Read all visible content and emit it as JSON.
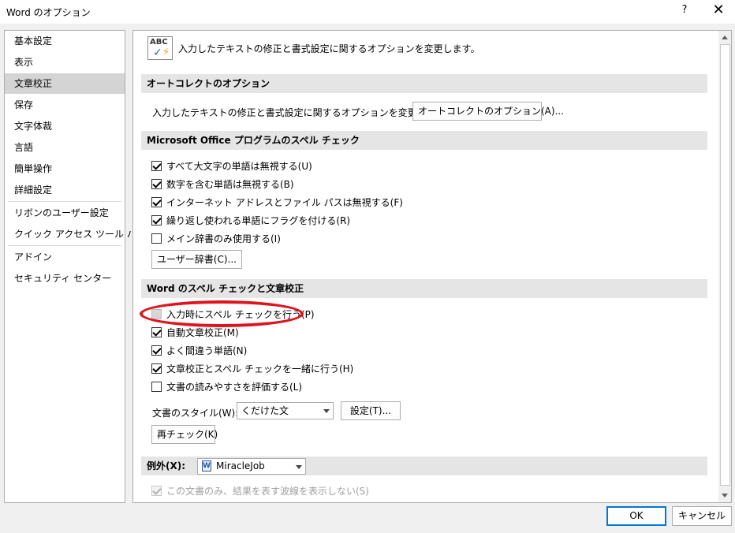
{
  "window": {
    "title": "Word のオプション",
    "help": "?",
    "close": "✕"
  },
  "sidebar": {
    "items": [
      {
        "label": "基本設定"
      },
      {
        "label": "表示"
      },
      {
        "label": "文章校正",
        "selected": true
      },
      {
        "label": "保存"
      },
      {
        "label": "文字体裁"
      },
      {
        "label": "言語"
      },
      {
        "label": "簡単操作"
      },
      {
        "label": "詳細設定"
      },
      {
        "label": "リボンのユーザー設定"
      },
      {
        "label": "クイック アクセス ツール バー"
      },
      {
        "label": "アドイン"
      },
      {
        "label": "セキュリティ センター"
      }
    ]
  },
  "header": {
    "icon": "abc-spellcheck-icon",
    "icon_text": "ABC",
    "text": "入力したテキストの修正と書式設定に関するオプションを変更します。"
  },
  "autocorrect": {
    "title": "オートコレクトのオプション",
    "description": "入力したテキストの修正と書式設定に関するオプションを変更します。",
    "button": "オートコレクトのオプション(A)..."
  },
  "office_spelling": {
    "title": "Microsoft Office プログラムのスペル チェック",
    "options": [
      {
        "label": "すべて大文字の単語は無視する(U)",
        "checked": true
      },
      {
        "label": "数字を含む単語は無視する(B)",
        "checked": true
      },
      {
        "label": "インターネット アドレスとファイル パスは無視する(F)",
        "checked": true
      },
      {
        "label": "繰り返し使われる単語にフラグを付ける(R)",
        "checked": true
      },
      {
        "label": "メイン辞書のみ使用する(I)",
        "checked": false
      }
    ],
    "dictionary_button": "ユーザー辞書(C)..."
  },
  "word_spelling": {
    "title": "Word のスペル チェックと文章校正",
    "options": [
      {
        "label": "入力時にスペル チェックを行う(P)",
        "checked": false
      },
      {
        "label": "自動文章校正(M)",
        "checked": true
      },
      {
        "label": "よく間違う単語(N)",
        "checked": true
      },
      {
        "label": "文章校正とスペル チェックを一緒に行う(H)",
        "checked": true
      },
      {
        "label": "文書の読みやすさを評価する(L)",
        "checked": false
      }
    ],
    "style_label": "文書のスタイル(W):",
    "style_value": "くだけた文",
    "settings_button": "設定(T)...",
    "recheck_button": "再チェック(K)"
  },
  "exceptions": {
    "label": "例外(X):",
    "document": "MiracleJob",
    "option_label": "この文書のみ、結果を表す波線を表示しない(S)",
    "option_checked": true
  },
  "footer": {
    "ok": "OK",
    "cancel": "キャンセル"
  },
  "colors": {
    "highlight": "#e0141e",
    "selected_bg": "#d4d4d4",
    "section_bg": "#e5e5e5",
    "primary_border": "#0078d7"
  }
}
